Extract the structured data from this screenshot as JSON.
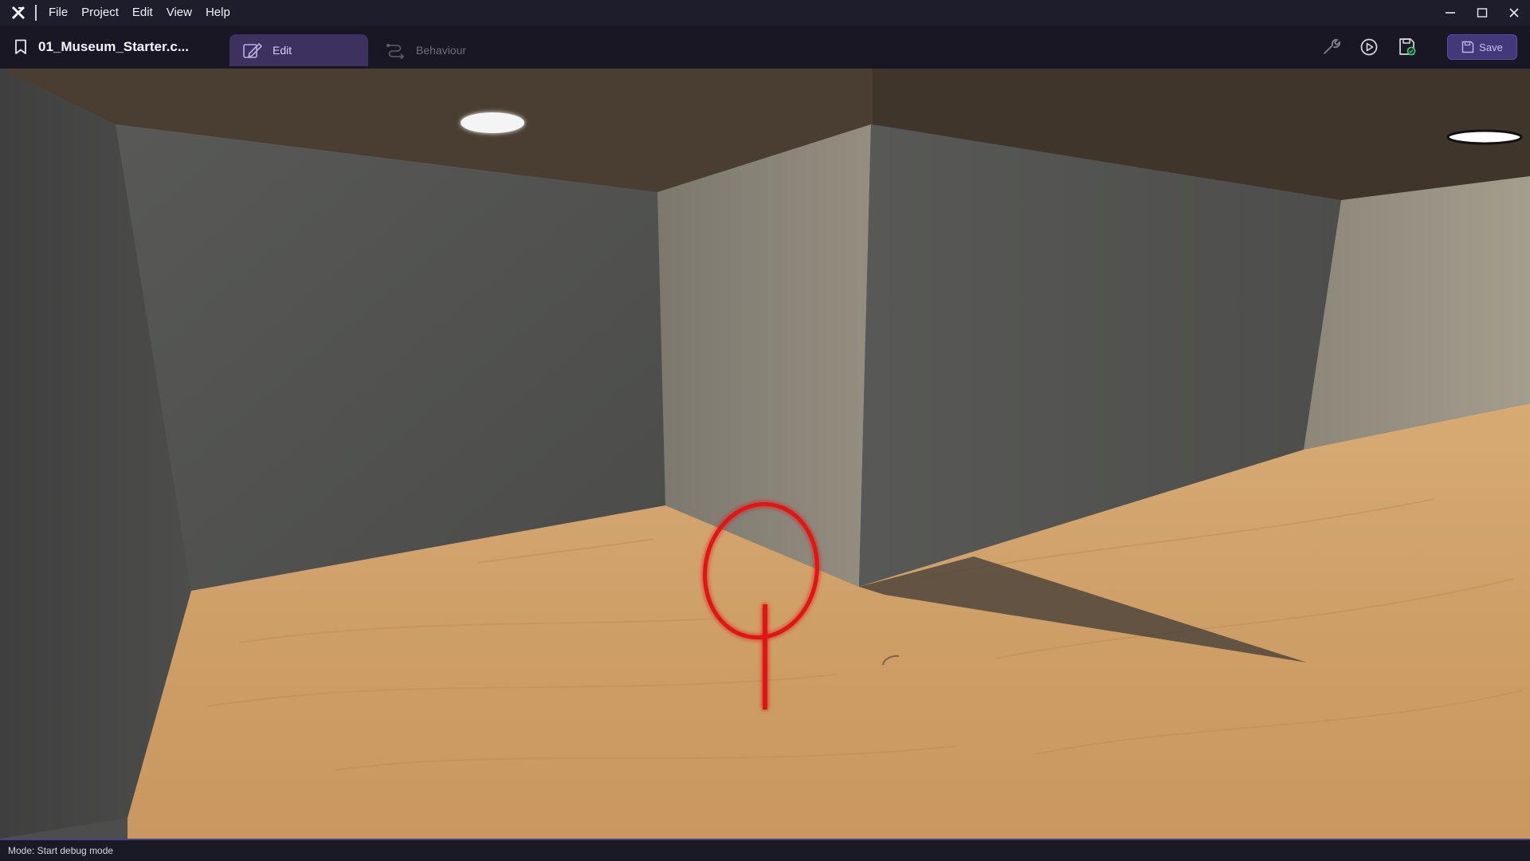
{
  "titlebar": {
    "logo_icon": "app-logo-icon",
    "menu": [
      "File",
      "Project",
      "Edit",
      "View",
      "Help"
    ],
    "window_controls": [
      "minimize-icon",
      "maximize-icon",
      "close-icon"
    ]
  },
  "toolbar": {
    "project_icon": "bookmark-icon",
    "project_name": "01_Museum_Starter.c...",
    "tabs": [
      {
        "label": "Edit",
        "icon": "edit-icon",
        "active": true
      },
      {
        "label": "Behaviour",
        "icon": "behaviour-icon",
        "active": false
      }
    ],
    "tools": [
      "wrench-icon",
      "play-icon",
      "build-icon"
    ],
    "save_label": "Save"
  },
  "status": {
    "text": "Mode: Start debug mode"
  },
  "colors": {
    "accent": "#43397a",
    "active_tab": "#3d325f",
    "cursor": "#e02020"
  }
}
